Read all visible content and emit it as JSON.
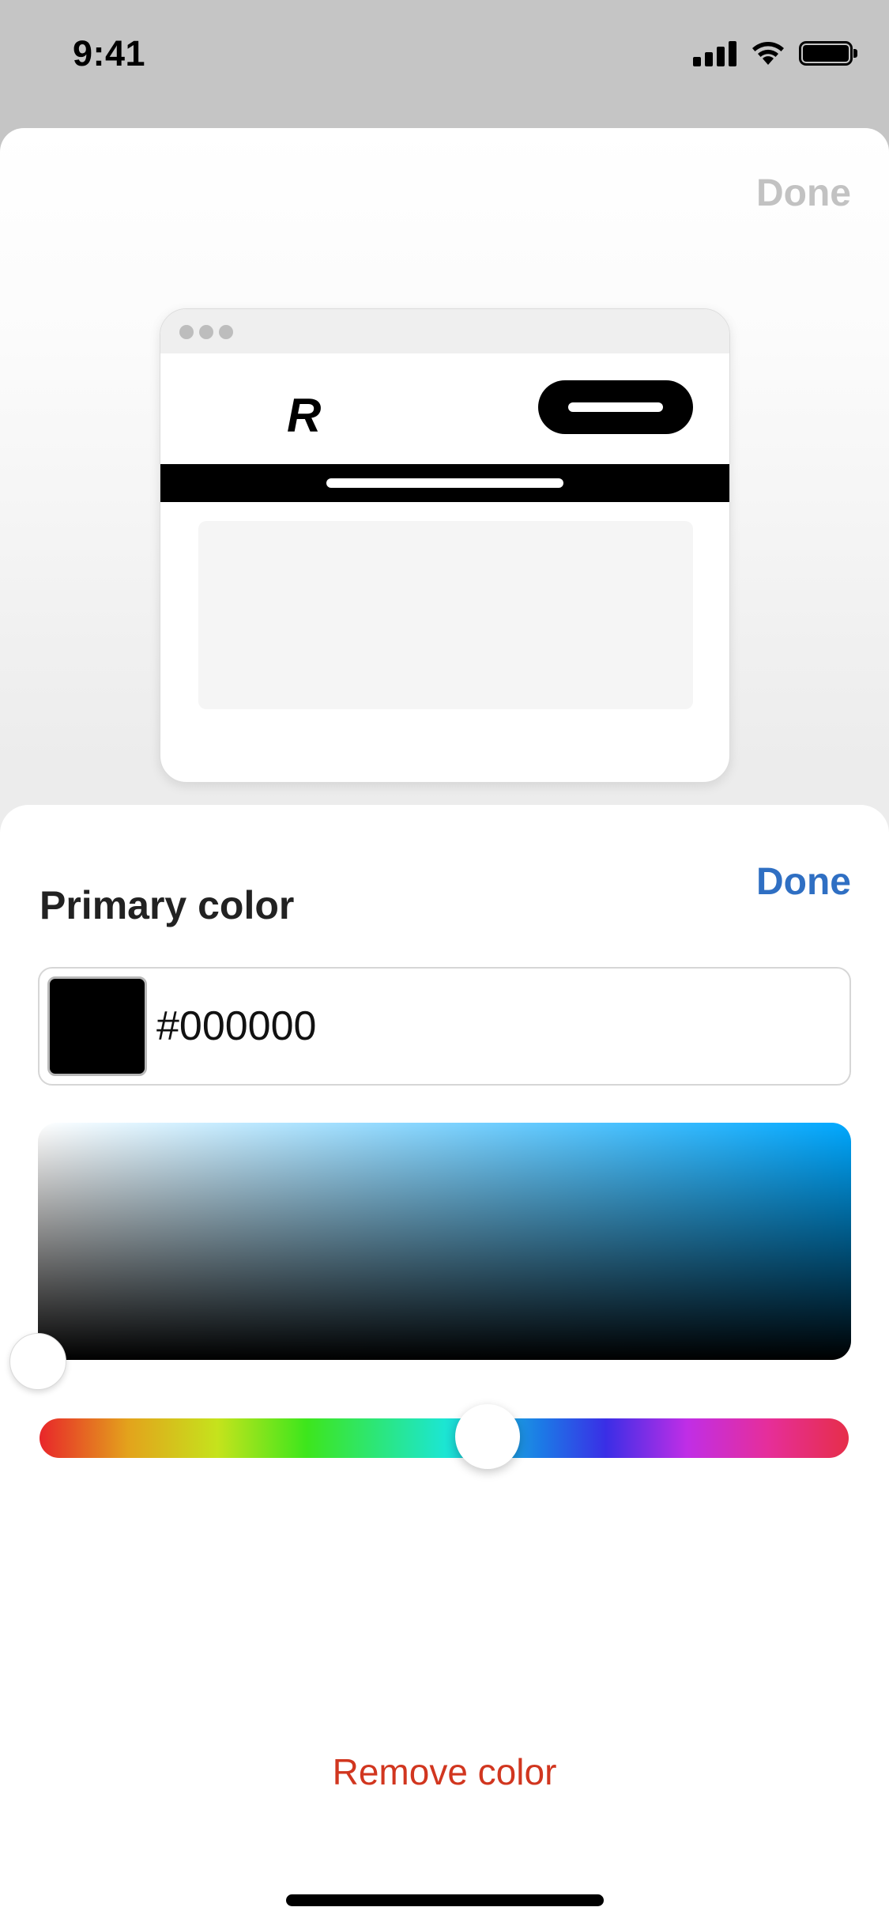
{
  "status_bar": {
    "time": "9:41"
  },
  "preview": {
    "done_label": "Done",
    "logo_letter": "R"
  },
  "picker": {
    "done_label": "Done",
    "title": "Primary color",
    "hex_value": "#000000",
    "remove_label": "Remove color",
    "colors": {
      "accent": "#2f6fc3",
      "destructive": "#d1361f",
      "selected": "#000000"
    }
  },
  "icons": {
    "signal": "cellular-signal-icon",
    "wifi": "wifi-icon",
    "battery": "battery-icon"
  }
}
